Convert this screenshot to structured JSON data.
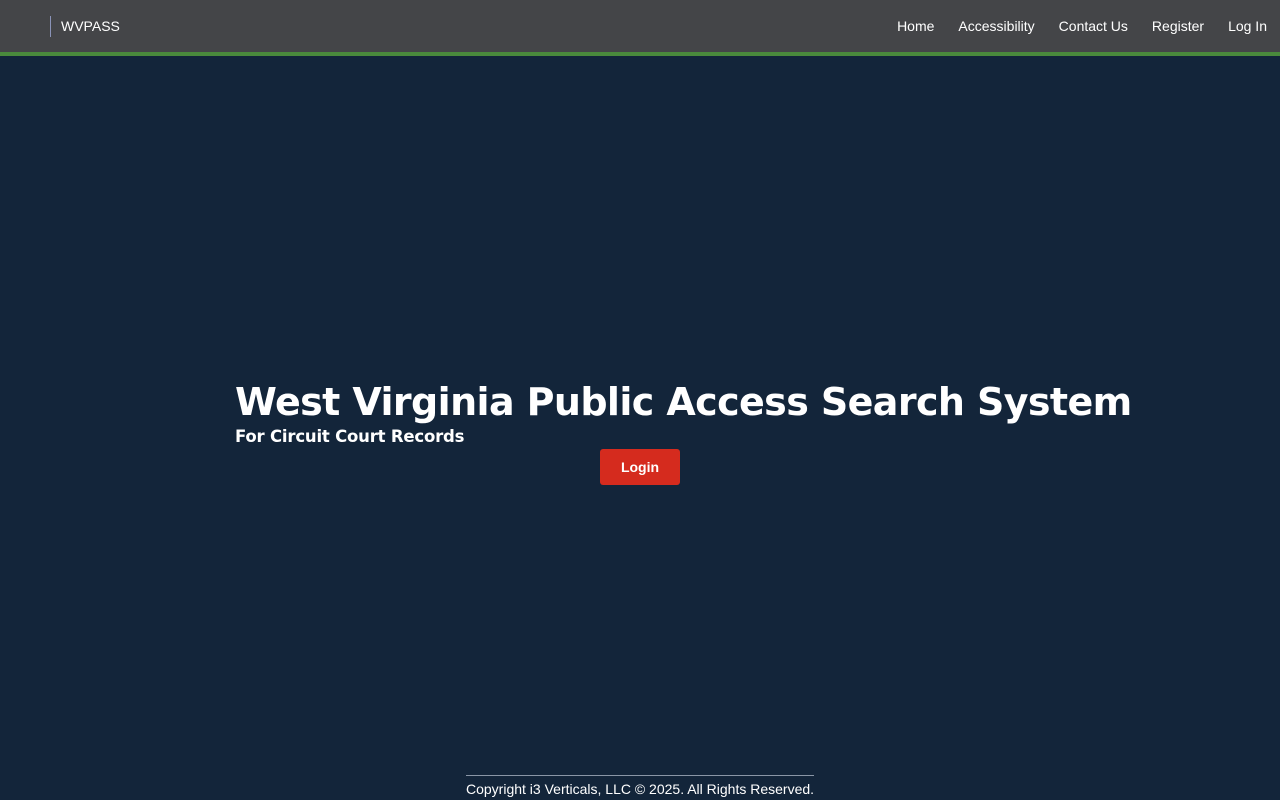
{
  "header": {
    "brand": "WVPASS",
    "nav": [
      "Home",
      "Accessibility",
      "Contact Us",
      "Register",
      "Log In"
    ]
  },
  "hero": {
    "title": "West Virginia Public Access Search System",
    "subtitle": "For Circuit Court Records",
    "login_label": "Login"
  },
  "footer": {
    "copyright": "Copyright i3 Verticals, LLC © 2025. All Rights Reserved."
  },
  "colors": {
    "background": "#13253a",
    "topbar": "#444548",
    "topbar_accent": "#4a8a3c",
    "button": "#d52b1e"
  }
}
